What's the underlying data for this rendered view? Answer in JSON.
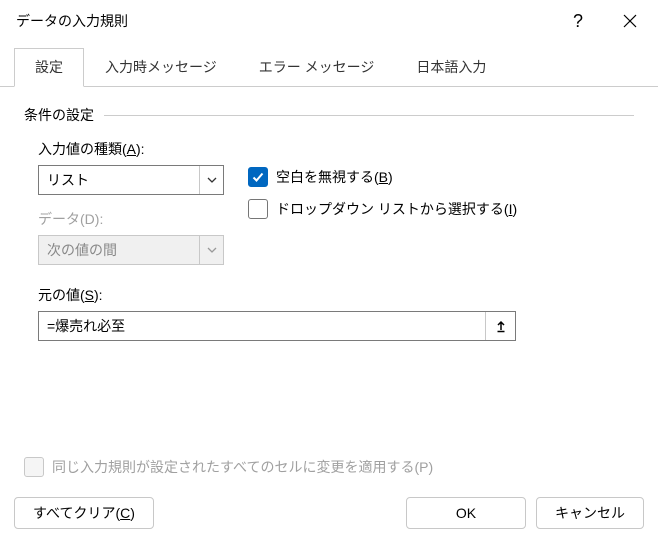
{
  "title": "データの入力規則",
  "tabs": {
    "settings": "設定",
    "input_msg": "入力時メッセージ",
    "error_msg": "エラー メッセージ",
    "ime": "日本語入力"
  },
  "section": {
    "criteria": "条件の設定"
  },
  "allow": {
    "label_pre": "入力値の種類(",
    "label_key": "A",
    "label_post": "):",
    "value": "リスト"
  },
  "data": {
    "label_pre": "データ(",
    "label_key": "D",
    "label_post": "):",
    "value": "次の値の間"
  },
  "ignore_blank": {
    "label_pre": "空白を無視する(",
    "label_key": "B",
    "label_post": ")",
    "checked": true
  },
  "dropdown": {
    "label_pre": "ドロップダウン リストから選択する(",
    "label_key": "I",
    "label_post": ")",
    "checked": false
  },
  "source": {
    "label_pre": "元の値(",
    "label_key": "S",
    "label_post": "):",
    "value": "=爆売れ必至"
  },
  "apply_all": {
    "label_pre": "同じ入力規則が設定されたすべてのセルに変更を適用する(",
    "label_key": "P",
    "label_post": ")"
  },
  "buttons": {
    "clear_pre": "すべてクリア(",
    "clear_key": "C",
    "clear_post": ")",
    "ok": "OK",
    "cancel": "キャンセル"
  }
}
